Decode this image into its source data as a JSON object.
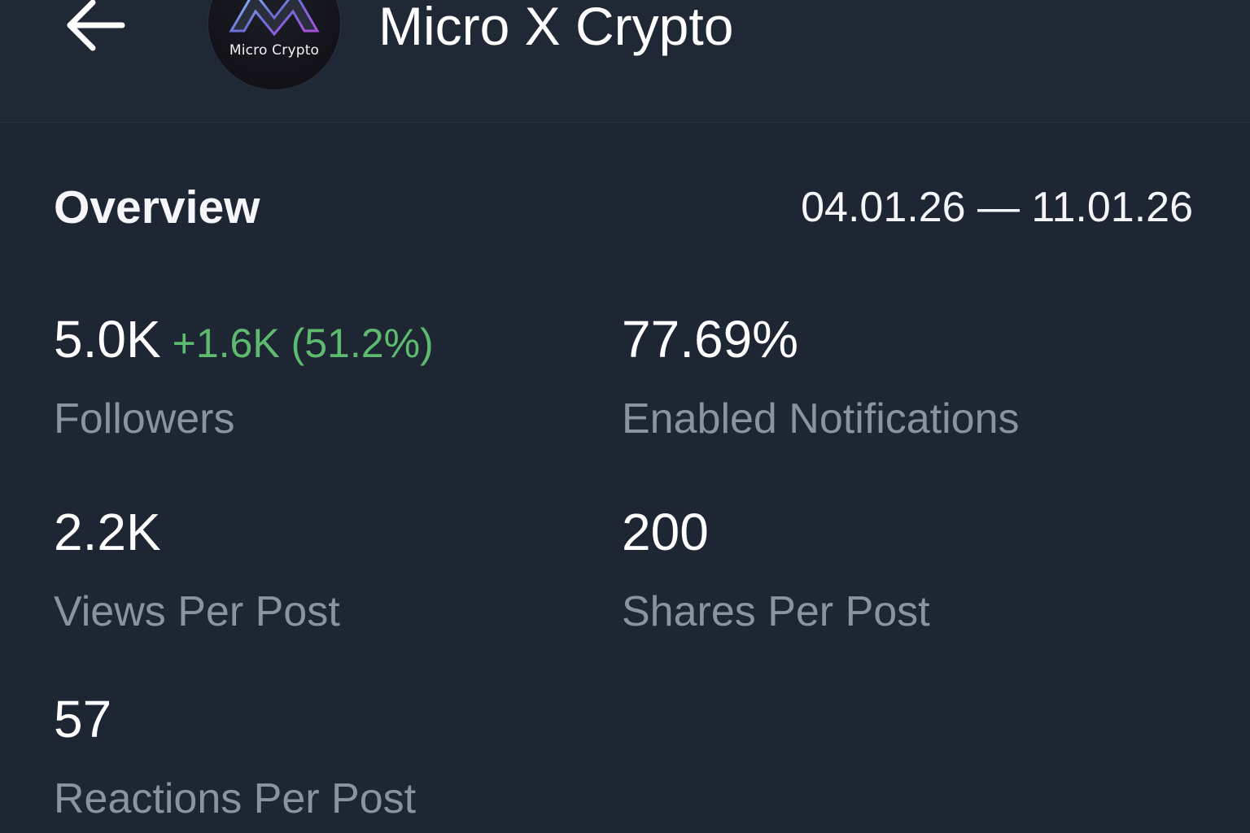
{
  "header": {
    "back_icon": "arrow-left-icon",
    "avatar_text": "Micro Crypto",
    "channel_title": "Micro X Crypto"
  },
  "overview": {
    "title": "Overview",
    "date_range": "04.01.26 — 11.01.26"
  },
  "stats": {
    "followers": {
      "value": "5.0K",
      "delta": "+1.6K (51.2%)",
      "label": "Followers"
    },
    "notifications": {
      "value": "77.69%",
      "label": "Enabled Notifications"
    },
    "views": {
      "value": "2.2K",
      "label": "Views Per Post"
    },
    "shares": {
      "value": "200",
      "label": "Shares Per Post"
    },
    "reactions": {
      "value": "57",
      "label": "Reactions Per Post"
    }
  },
  "colors": {
    "background": "#1f2633",
    "text_primary": "#ffffff",
    "text_secondary": "#8a93a0",
    "positive_delta": "#5dbb6e"
  }
}
